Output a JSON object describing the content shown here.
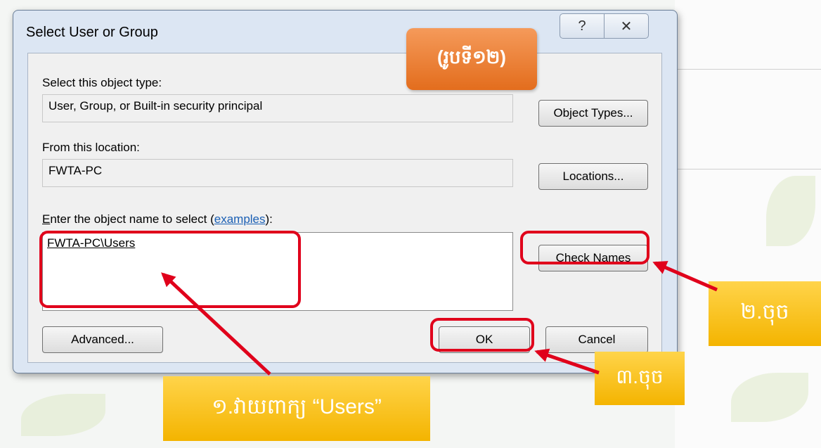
{
  "dialog": {
    "title": "Select User or Group",
    "help_glyph": "?",
    "close_glyph": "✕",
    "object_type_label": "Select this object type:",
    "object_type_value": "User, Group, or Built-in security principal",
    "object_types_button": "Object Types...",
    "location_label": "From this location:",
    "location_value": "FWTA-PC",
    "locations_button": "Locations...",
    "enter_label_prefix_underlined": "E",
    "enter_label_rest": "nter the object name to select (",
    "examples_link": "examples",
    "enter_label_suffix": "):",
    "object_name_value": "FWTA-PC\\Users",
    "check_names_button": "Check Names",
    "advanced_button": "Advanced...",
    "ok_button": "OK",
    "cancel_button": "Cancel"
  },
  "annotations": {
    "figure_badge": "(រូបទី១២)",
    "step1": "១.វាយពាក្យ “Users”",
    "step2": "២.ចុច",
    "step3": "៣.ចុច"
  },
  "colors": {
    "highlight": "#e0001b",
    "orange_badge": "#e36d1d",
    "yellow_badge": "#f4b400"
  }
}
